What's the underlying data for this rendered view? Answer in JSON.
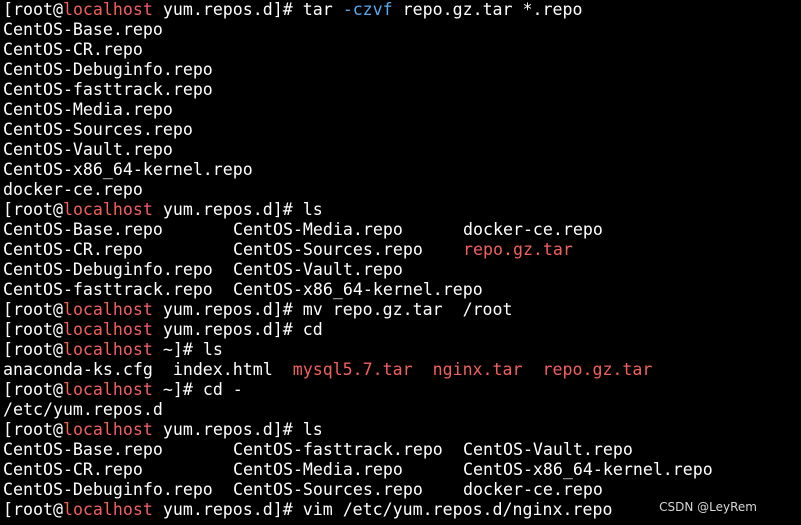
{
  "terminal": {
    "lines": [
      {
        "segs": [
          {
            "t": "[root@",
            "c": "normal"
          },
          {
            "t": "localhost",
            "c": "host"
          },
          {
            "t": " yum.repos.d]# tar ",
            "c": "normal"
          },
          {
            "t": "-czvf",
            "c": "opt"
          },
          {
            "t": " repo.gz.tar *.repo",
            "c": "normal"
          }
        ]
      },
      {
        "segs": [
          {
            "t": "CentOS-Base.repo",
            "c": "normal"
          }
        ]
      },
      {
        "segs": [
          {
            "t": "CentOS-CR.repo",
            "c": "normal"
          }
        ]
      },
      {
        "segs": [
          {
            "t": "CentOS-Debuginfo.repo",
            "c": "normal"
          }
        ]
      },
      {
        "segs": [
          {
            "t": "CentOS-fasttrack.repo",
            "c": "normal"
          }
        ]
      },
      {
        "segs": [
          {
            "t": "CentOS-Media.repo",
            "c": "normal"
          }
        ]
      },
      {
        "segs": [
          {
            "t": "CentOS-Sources.repo",
            "c": "normal"
          }
        ]
      },
      {
        "segs": [
          {
            "t": "CentOS-Vault.repo",
            "c": "normal"
          }
        ]
      },
      {
        "segs": [
          {
            "t": "CentOS-x86_64-kernel.repo",
            "c": "normal"
          }
        ]
      },
      {
        "segs": [
          {
            "t": "docker-ce.repo",
            "c": "normal"
          }
        ]
      },
      {
        "segs": [
          {
            "t": "[root@",
            "c": "normal"
          },
          {
            "t": "localhost",
            "c": "host"
          },
          {
            "t": " yum.repos.d]# ls",
            "c": "normal"
          }
        ]
      },
      {
        "cols": [
          {
            "t": "CentOS-Base.repo",
            "c": "normal"
          },
          {
            "t": "CentOS-Media.repo",
            "c": "normal"
          },
          {
            "t": "docker-ce.repo",
            "c": "normal"
          }
        ]
      },
      {
        "cols": [
          {
            "t": "CentOS-CR.repo",
            "c": "normal"
          },
          {
            "t": "CentOS-Sources.repo",
            "c": "normal"
          },
          {
            "t": "repo.gz.tar",
            "c": "file"
          }
        ]
      },
      {
        "cols": [
          {
            "t": "CentOS-Debuginfo.repo",
            "c": "normal"
          },
          {
            "t": "CentOS-Vault.repo",
            "c": "normal"
          }
        ]
      },
      {
        "cols": [
          {
            "t": "CentOS-fasttrack.repo",
            "c": "normal"
          },
          {
            "t": "CentOS-x86_64-kernel.repo",
            "c": "normal"
          }
        ]
      },
      {
        "segs": [
          {
            "t": "[root@",
            "c": "normal"
          },
          {
            "t": "localhost",
            "c": "host"
          },
          {
            "t": " yum.repos.d]# mv repo.gz.tar  /root",
            "c": "normal"
          }
        ]
      },
      {
        "segs": [
          {
            "t": "[root@",
            "c": "normal"
          },
          {
            "t": "localhost",
            "c": "host"
          },
          {
            "t": " yum.repos.d]# cd",
            "c": "normal"
          }
        ]
      },
      {
        "segs": [
          {
            "t": "[root@",
            "c": "normal"
          },
          {
            "t": "localhost",
            "c": "host"
          },
          {
            "t": " ~]# ls",
            "c": "normal"
          }
        ]
      },
      {
        "segs": [
          {
            "t": "anaconda-ks.cfg  index.html  ",
            "c": "normal"
          },
          {
            "t": "mysql5.7.tar",
            "c": "file"
          },
          {
            "t": "  ",
            "c": "normal"
          },
          {
            "t": "nginx.tar",
            "c": "file"
          },
          {
            "t": "  ",
            "c": "normal"
          },
          {
            "t": "repo.gz.tar",
            "c": "file"
          }
        ]
      },
      {
        "segs": [
          {
            "t": "[root@",
            "c": "normal"
          },
          {
            "t": "localhost",
            "c": "host"
          },
          {
            "t": " ~]# cd -",
            "c": "normal"
          }
        ]
      },
      {
        "segs": [
          {
            "t": "/etc/yum.repos.d",
            "c": "normal"
          }
        ]
      },
      {
        "segs": [
          {
            "t": "[root@",
            "c": "normal"
          },
          {
            "t": "localhost",
            "c": "host"
          },
          {
            "t": " yum.repos.d]# ls",
            "c": "normal"
          }
        ]
      },
      {
        "cols": [
          {
            "t": "CentOS-Base.repo",
            "c": "normal"
          },
          {
            "t": "CentOS-fasttrack.repo",
            "c": "normal"
          },
          {
            "t": "CentOS-Vault.repo",
            "c": "normal"
          }
        ]
      },
      {
        "cols": [
          {
            "t": "CentOS-CR.repo",
            "c": "normal"
          },
          {
            "t": "CentOS-Media.repo",
            "c": "normal"
          },
          {
            "t": "CentOS-x86_64-kernel.repo",
            "c": "normal"
          }
        ]
      },
      {
        "cols": [
          {
            "t": "CentOS-Debuginfo.repo",
            "c": "normal"
          },
          {
            "t": "CentOS-Sources.repo",
            "c": "normal"
          },
          {
            "t": "docker-ce.repo",
            "c": "normal"
          }
        ]
      },
      {
        "segs": [
          {
            "t": "[root@",
            "c": "normal"
          },
          {
            "t": "localhost",
            "c": "host"
          },
          {
            "t": " yum.repos.d]# vim /etc/yum.repos.d/nginx.repo",
            "c": "normal"
          }
        ]
      }
    ]
  },
  "watermark": "CSDN @LeyRem",
  "colors": {
    "background": "#000000",
    "foreground": "#ffffff",
    "hostname": "#f0605e",
    "option": "#5aa8ee",
    "archive_file": "#f0605e"
  }
}
